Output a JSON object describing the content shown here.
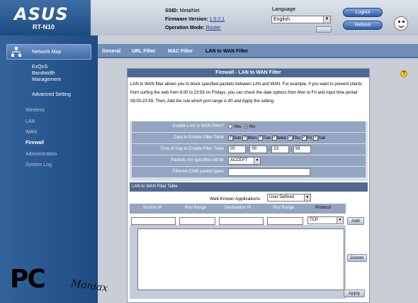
{
  "header": {
    "brand": "ASUS",
    "model": "RT-N10",
    "ssid_label": "SSID:",
    "ssid_value": "MetalNet",
    "firmware_label": "Firmware Version:",
    "firmware_value": "1.0.2.1",
    "mode_label": "Operation Mode:",
    "mode_value": "Router",
    "language_label": "Language",
    "language_value": "English",
    "logout_label": "Logout",
    "reboot_label": "Reboot"
  },
  "sidebar": {
    "network_map": "Network Map",
    "ezqos": "EzQoS\nBandwidth\nManagement",
    "advanced": "Advanced Setting",
    "items": [
      "Wireless",
      "LAN",
      "WAN",
      "Firewall",
      "Administration",
      "System Log"
    ]
  },
  "tabs": [
    "General",
    "URL Filter",
    "MAC Filter",
    "LAN to WAN Filter"
  ],
  "panel": {
    "title": "Firewall - LAN to WAN Filter",
    "description": "LAN to WAN filter allows you to block specified packets between LAN and WAN. For example, if you want to prevent clients from surfing the web from 8:00 to 23:59 on Fridays, you can check the date options from Mon to Fri and input time period 08:00-23:59. Then, Add the rule which port range is 80 and Apply the setting.",
    "enable_label": "Enable LAN to WAN Filter?",
    "yes": "Yes",
    "no": "No",
    "date_label": "Date to Enable Filter Table",
    "days": [
      "Sun",
      "Mon",
      "Tue",
      "Wed",
      "Thu",
      "Fri",
      "Sat"
    ],
    "time_label": "Time of Day to Enable Filter Table",
    "time": {
      "h1": "00",
      "m1": "00",
      "sep": ":",
      "dash": "-",
      "h2": "23",
      "m2": "59"
    },
    "packets_label": "Packets not specified will be",
    "packets_value": "ACCEPT",
    "icmp_label": "Filtered ICMP packet types",
    "icmp_value": "",
    "table_title": "LAN to WAN Filter Table",
    "wk_label": "Well-Known Applications",
    "wk_value": "User Defined",
    "cols": [
      "Source IP",
      "Port Range",
      "Destination IP",
      "Port Range",
      "Protocol"
    ],
    "protocol_value": "TCP",
    "add": "Add",
    "delete": "Delete",
    "apply": "Apply"
  },
  "watermark": {
    "pc": "PC",
    "maniax": "Maniax"
  }
}
